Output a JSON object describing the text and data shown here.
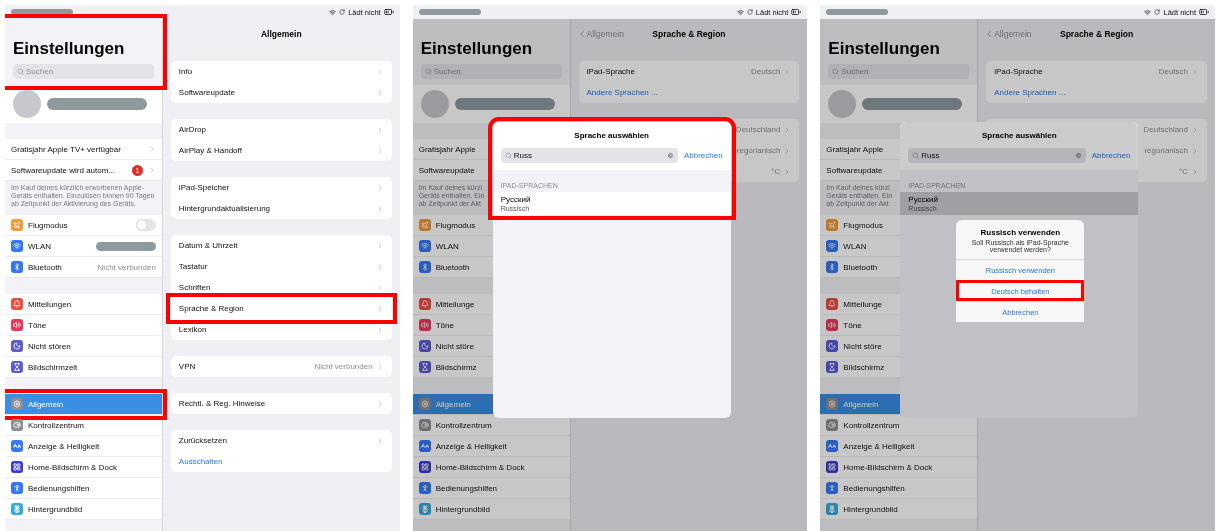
{
  "panels": [
    {
      "dimmed": false,
      "status_bar": {
        "text": "Lädt nicht"
      },
      "sidebar": {
        "title": "Einstellungen",
        "header_highlighted": true,
        "search_placeholder": "Suchen",
        "groups": [
          {
            "rows": [
              {
                "kind": "chevron",
                "label": "Gratisjahr Apple TV+ verfügbar",
                "selected": false
              },
              {
                "kind": "chevron",
                "label": "Softwareupdate wird autom...",
                "badge": "1",
                "selected": false
              }
            ],
            "footnote_lines": [
              "Im Kauf deines kürzlich erworbenen Apple-",
              "Geräts enthalten. Einzulösen binnen 90 Tagen",
              "ab Zeitpunkt der Aktivierung des Geräts."
            ]
          },
          {
            "rows": [
              {
                "kind": "toggle",
                "label": "Flugmodus",
                "color": "#f09a37",
                "on": false,
                "selected": false
              },
              {
                "kind": "redacted",
                "label": "WLAN",
                "color": "#3478f6",
                "selected": false
              },
              {
                "kind": "value",
                "label": "Bluetooth",
                "color": "#3478f6",
                "value": "Nicht verbunden",
                "selected": false
              }
            ]
          },
          {
            "rows": [
              {
                "kind": "plain",
                "label": "Mitteilungen",
                "color": "#eb4d3d",
                "selected": false
              },
              {
                "kind": "plain",
                "label": "Töne",
                "color": "#e9375a",
                "selected": false
              },
              {
                "kind": "plain",
                "label": "Nicht stören",
                "color": "#5b5bd6",
                "selected": false
              },
              {
                "kind": "plain",
                "label": "Bildschirmzeit",
                "color": "#5b5bd6",
                "selected": false
              }
            ]
          },
          {
            "rows": [
              {
                "kind": "plain",
                "label": "Allgemein",
                "color": "#8e8e93",
                "selected": true,
                "highlighted": true
              },
              {
                "kind": "plain",
                "label": "Kontrollzentrum",
                "color": "#8e8e93",
                "selected": false,
                "highlighted": false
              },
              {
                "kind": "plain",
                "label": "Anzeige & Helligkeit",
                "color": "#3478f6",
                "selected": false,
                "highlighted": false
              },
              {
                "kind": "plain",
                "label": "Home-Bildschirm & Dock",
                "color": "#3a3ad0",
                "selected": false,
                "highlighted": false
              },
              {
                "kind": "plain",
                "label": "Bedienungshilfen",
                "color": "#3478f6",
                "selected": false,
                "highlighted": false
              },
              {
                "kind": "plain",
                "label": "Hintergrundbild",
                "color": "#36aadc",
                "selected": false,
                "highlighted": false
              }
            ]
          }
        ]
      },
      "detail": {
        "title": "Allgemein",
        "groups": [
          {
            "rows": [
              {
                "kind": "chevron",
                "label": "Info"
              },
              {
                "kind": "chevron",
                "label": "Softwareupdate"
              }
            ]
          },
          {
            "rows": [
              {
                "kind": "chevron",
                "label": "AirDrop"
              },
              {
                "kind": "chevron",
                "label": "AirPlay & Handoff"
              }
            ]
          },
          {
            "rows": [
              {
                "kind": "chevron",
                "label": "iPad-Speicher"
              },
              {
                "kind": "chevron",
                "label": "Hintergrundaktualisierung"
              }
            ]
          },
          {
            "rows": [
              {
                "kind": "chevron",
                "label": "Datum & Uhrzeit",
                "highlighted": false
              },
              {
                "kind": "chevron",
                "label": "Tastatur",
                "highlighted": false
              },
              {
                "kind": "chevron",
                "label": "Schriften",
                "highlighted": false
              },
              {
                "kind": "chevron",
                "label": "Sprache & Region",
                "highlighted": true
              },
              {
                "kind": "chevron",
                "label": "Lexikon",
                "highlighted": false
              }
            ]
          },
          {
            "rows": [
              {
                "kind": "chevron",
                "label": "VPN",
                "value": "Nicht verbunden"
              }
            ]
          },
          {
            "rows": [
              {
                "kind": "chevron",
                "label": "Rechtl. & Reg. Hinweise"
              }
            ]
          },
          {
            "rows": [
              {
                "kind": "chevron",
                "label": "Zurücksetzen"
              },
              {
                "kind": "action",
                "label": "Ausschalten"
              }
            ]
          }
        ]
      }
    },
    {
      "dimmed": true,
      "status_bar": {
        "text": "Lädt nicht"
      },
      "sidebar": {
        "title": "Einstellungen",
        "header_highlighted": false,
        "search_placeholder": "Suchen",
        "groups": [
          {
            "rows": [
              {
                "kind": "plain",
                "label": "Gratisjahr Apple",
                "selected": false
              },
              {
                "kind": "plain",
                "label": "Softwareupdate",
                "selected": false
              }
            ],
            "footnote_lines": [
              "Im Kauf deines kürzl",
              "Geräts enthalten. Ein",
              "ab Zeitpunkt der Akt"
            ]
          },
          {
            "rows": [
              {
                "kind": "plain",
                "label": "Flugmodus",
                "color": "#bb782b",
                "selected": false
              },
              {
                "kind": "plain",
                "label": "WLAN",
                "color": "#295ec0",
                "selected": false
              },
              {
                "kind": "plain",
                "label": "Bluetooth",
                "color": "#295ec0",
                "selected": false
              }
            ]
          },
          {
            "rows": [
              {
                "kind": "plain",
                "label": "Mitteilunge",
                "color": "#b73c30",
                "selected": false
              },
              {
                "kind": "plain",
                "label": "Töne",
                "color": "#b62b46",
                "selected": false
              },
              {
                "kind": "plain",
                "label": "Nicht störe",
                "color": "#4747a7",
                "selected": false
              },
              {
                "kind": "plain",
                "label": "Bildschirmz",
                "color": "#4747a7",
                "selected": false
              }
            ]
          },
          {
            "rows": [
              {
                "kind": "plain",
                "label": "Allgemein",
                "color": "#6f6f73",
                "selected": true
              },
              {
                "kind": "plain",
                "label": "Kontrollzentrum",
                "color": "#6f6f73",
                "selected": false
              },
              {
                "kind": "plain",
                "label": "Anzeige & Helligkeit",
                "color": "#295ec0",
                "selected": false
              },
              {
                "kind": "plain",
                "label": "Home-Bildschirm & Dock",
                "color": "#2d2da2",
                "selected": false
              },
              {
                "kind": "plain",
                "label": "Bedienungshilfen",
                "color": "#295ec0",
                "selected": false
              },
              {
                "kind": "plain",
                "label": "Hintergrundbild",
                "color": "#2a85ac",
                "selected": false
              }
            ]
          }
        ]
      },
      "detail": {
        "back": "Allgemein",
        "title": "Sprache & Region",
        "groups": [
          {
            "rows": [
              {
                "kind": "chevron",
                "label": "iPad-Sprache",
                "value": "Deutsch"
              },
              {
                "kind": "action",
                "label": "Andere Sprachen ..."
              }
            ]
          },
          {
            "rows": [
              {
                "kind": "chevron",
                "value": "Deutschland"
              },
              {
                "kind": "chevron",
                "value": "regorianisch"
              },
              {
                "kind": "chevron",
                "value": "°C"
              }
            ]
          }
        ]
      },
      "sheet": {
        "title": "Sprache auswählen",
        "search_value": "Russ",
        "cancel": "Abbrechen",
        "section": "IPAD-SPRACHEN",
        "highlighted": true,
        "dimmed": false,
        "results": [
          {
            "label": "Русский",
            "subtitle": "Russisch",
            "selected": false
          }
        ]
      }
    },
    {
      "dimmed": true,
      "status_bar": {
        "text": "Lädt nicht"
      },
      "sidebar": {
        "title": "Einstellungen",
        "header_highlighted": false,
        "search_placeholder": "Suchen",
        "groups": [
          {
            "rows": [
              {
                "kind": "plain",
                "label": "Gratisjahr Apple",
                "selected": false
              },
              {
                "kind": "plain",
                "label": "Softwareupdate",
                "selected": false
              }
            ],
            "footnote_lines": [
              "Im Kauf deines kürzl",
              "Geräts enthalten. Ein",
              "ab Zeitpunkt der Akt"
            ]
          },
          {
            "rows": [
              {
                "kind": "plain",
                "label": "Flugmodus",
                "color": "#bb782b",
                "selected": false
              },
              {
                "kind": "plain",
                "label": "WLAN",
                "color": "#295ec0",
                "selected": false
              },
              {
                "kind": "plain",
                "label": "Bluetooth",
                "color": "#295ec0",
                "selected": false
              }
            ]
          },
          {
            "rows": [
              {
                "kind": "plain",
                "label": "Mitteilunge",
                "color": "#b73c30",
                "selected": false
              },
              {
                "kind": "plain",
                "label": "Töne",
                "color": "#b62b46",
                "selected": false
              },
              {
                "kind": "plain",
                "label": "Nicht störe",
                "color": "#4747a7",
                "selected": false
              },
              {
                "kind": "plain",
                "label": "Bildschirmz",
                "color": "#4747a7",
                "selected": false
              }
            ]
          },
          {
            "rows": [
              {
                "kind": "plain",
                "label": "Allgemein",
                "color": "#6f6f73",
                "selected": true
              },
              {
                "kind": "plain",
                "label": "Kontrollzentrum",
                "color": "#6f6f73",
                "selected": false
              },
              {
                "kind": "plain",
                "label": "Anzeige & Helligkeit",
                "color": "#295ec0",
                "selected": false
              },
              {
                "kind": "plain",
                "label": "Home-Bildschirm & Dock",
                "color": "#2d2da2",
                "selected": false
              },
              {
                "kind": "plain",
                "label": "Bedienungshilfen",
                "color": "#295ec0",
                "selected": false
              },
              {
                "kind": "plain",
                "label": "Hintergrundbild",
                "color": "#2a85ac",
                "selected": false
              }
            ]
          }
        ]
      },
      "detail": {
        "back": "Allgemein",
        "title": "Sprache & Region",
        "groups": [
          {
            "rows": [
              {
                "kind": "chevron",
                "label": "iPad-Sprache",
                "value": "Deutsch"
              },
              {
                "kind": "action",
                "label": "Andere Sprachen ..."
              }
            ]
          },
          {
            "rows": [
              {
                "kind": "chevron",
                "value": "Deutschland"
              },
              {
                "kind": "chevron",
                "value": "regorianisch"
              },
              {
                "kind": "chevron",
                "value": "°C"
              }
            ]
          }
        ]
      },
      "sheet": {
        "title": "Sprache auswählen",
        "search_value": "Russ",
        "cancel": "Abbrechen",
        "section": "IPAD-SPRACHEN",
        "highlighted": false,
        "dimmed": true,
        "results": [
          {
            "label": "Русский",
            "subtitle": "Russisch",
            "selected": true
          }
        ]
      },
      "alert": {
        "title": "Russisch verwenden",
        "message": "Soll Russisch als iPad-Sprache verwendet werden?",
        "actions": [
          {
            "label": "Russisch verwenden",
            "highlighted": false
          },
          {
            "label": "Deutsch behalten",
            "highlighted": true
          },
          {
            "label": "Abbrechen",
            "highlighted": false
          }
        ]
      }
    }
  ]
}
